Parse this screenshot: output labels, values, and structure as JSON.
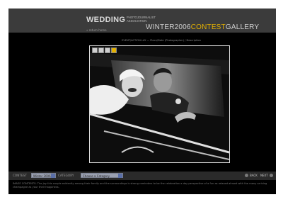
{
  "header": {
    "logo_main": "WEDDING",
    "logo_sub": "PHOTOJOURNALIST ASSOCIATION",
    "home_link": "« return home",
    "contest_season": "WINTER2006",
    "contest_word": "CONTEST",
    "gallery_word": "GALLERY"
  },
  "photo": {
    "meta": "EVENT/ACTION LAY — Place/Date (Photographer) / Description",
    "alt": "Bride and groom leaning out of a classic black car window, laughing"
  },
  "toolbar": {
    "icons": [
      "zoom-icon",
      "print-icon",
      "save-icon",
      "info-icon"
    ]
  },
  "filters": {
    "contest_label": "CONTEST",
    "contest_value": "Winter 2006",
    "category_label": "CATEGORY",
    "category_value": "Choose a Category"
  },
  "navigation": {
    "back_label": "BACK",
    "next_label": "NEXT"
  },
  "caption": {
    "text": "IMAGE CONTENTS: The joy this couple evidently among their family and the surroundings is strong reminders to be the celebration a day perspective of a fun as relaxed almost with the many arriving champagne as your their happiness."
  }
}
